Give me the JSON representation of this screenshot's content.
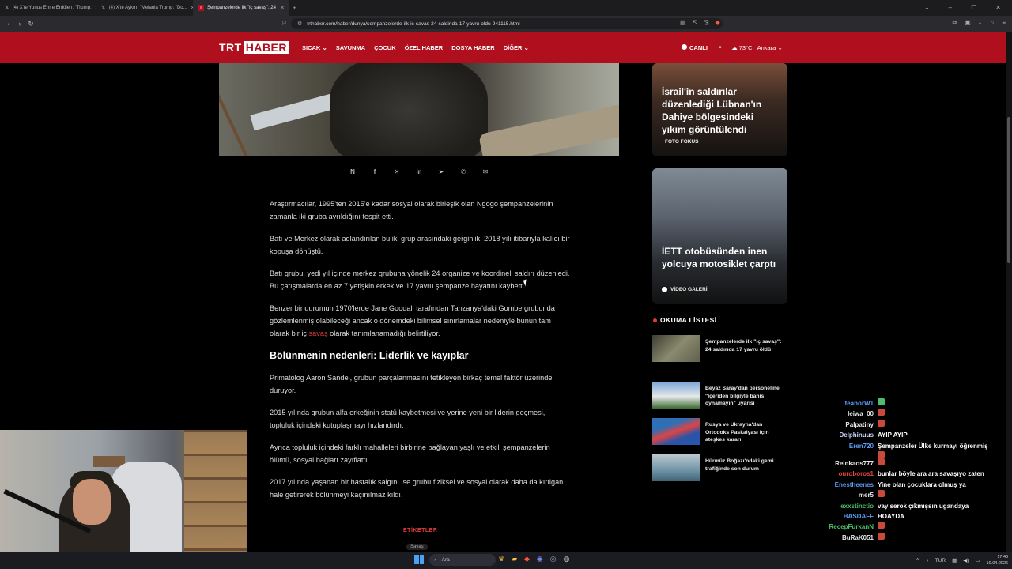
{
  "browser": {
    "tabs": [
      {
        "label": "(4) X'te Yunus Emre Erdölen: \"Trump:",
        "active": false
      },
      {
        "label": "(4) X'te Aykırı: \"Melania Trump: \"Do...",
        "active": false
      },
      {
        "label": "Şempanzelerde ilk \"iç savaş\": 24",
        "active": true
      }
    ],
    "url": "trthaber.com/haber/dunya/sempanzelerde-ilk-ic-savas-24-saldirida-17-yavru-oldu-941115.html"
  },
  "site": {
    "logo_trt": "TRT",
    "logo_haber": "HABER",
    "nav": [
      "SICAK",
      "SAVUNMA",
      "ÇOCUK",
      "ÖZEL HABER",
      "DOSYA HABER",
      "DİĞER"
    ],
    "live_label": "CANLI",
    "weather": "73°C",
    "city": "Ankara"
  },
  "share_icons": [
    "N",
    "f",
    "x-icon",
    "in",
    "telegram-icon",
    "whatsapp-icon",
    "mail-icon"
  ],
  "article": {
    "p1": "Araştırmacılar, 1995'ten 2015'e kadar sosyal olarak birleşik olan Ngogo şempanzelerinin zamanla iki gruba ayrıldığını tespit etti.",
    "p2": "Batı ve Merkez olarak adlandırılan bu iki grup arasındaki gerginlik, 2018 yılı itibarıyla kalıcı bir kopuşa dönüştü.",
    "p3": "Batı grubu, yedi yıl içinde merkez grubuna yönelik 24 organize ve koordineli saldırı düzenledi. Bu çatışmalarda en az 7 yetişkin erkek ve 17 yavru şempanze hayatını kaybetti.",
    "p4_before": "Benzer bir durumun 1970'lerde Jane Goodall tarafından Tanzanya'daki Gombe grubunda gözlemlenmiş olabileceği ancak o dönemdeki bilimsel sınırlamalar nedeniyle bunun tam olarak bir iç ",
    "p4_link": "savaş",
    "p4_after": " olarak tanımlanamadığı belirtiliyor.",
    "h2": "Bölünmenin nedenleri: Liderlik ve kayıplar",
    "p5": "Primatolog Aaron Sandel, grubun parçalanmasını tetikleyen birkaç temel faktör üzerinde duruyor.",
    "p6": "2015 yılında grubun alfa erkeğinin statü kaybetmesi ve yerine yeni bir liderin geçmesi, topluluk içindeki kutuplaşmayı hızlandırdı.",
    "p7": "Ayrıca topluluk içindeki farklı mahalleleri birbirine bağlayan yaşlı ve etkili şempanzelerin ölümü, sosyal bağları zayıflattı.",
    "p8": "2017 yılında yaşanan bir hastalık salgını ise grubu fiziksel ve sosyal olarak daha da kırılgan hale getirerek bölünmeyi kaçınılmaz kıldı.",
    "tags_title": "ETİKETLER",
    "tag1": "Savaş"
  },
  "sidebar": {
    "card1": {
      "title": "İsrail'in saldırılar düzenlediği Lübnan'ın Dahiye bölgesindeki yıkım görüntülendi",
      "tag": "FOTO FOKUS"
    },
    "card2": {
      "title": "İETT otobüsünden inen yolcuya motosiklet çarptı",
      "tag": "VİDEO GALERİ"
    },
    "reading_title": "OKUMA LİSTESİ",
    "reading": [
      {
        "text": "Şempanzelerde ilk \"iç savaş\": 24 saldırıda 17 yavru öldü",
        "color": "#6b6a55"
      },
      {
        "text": "Beyaz Saray'dan personeline \"içeriden bilgiyle bahis oynamayın\" uyarısı",
        "color": "#5a84b8"
      },
      {
        "text": "Rusya ve Ukrayna'dan Ortodoks Paskalyası için ateşkes kararı",
        "color": "#2f6fb5"
      },
      {
        "text": "Hürmüz Boğazı'ndaki gemi trafiğinde son durum",
        "color": "#6f93a6"
      }
    ]
  },
  "chat": [
    {
      "user": "feanorW1",
      "msg": "",
      "color": "#5a9cf5",
      "emote": "green"
    },
    {
      "user": "leiwa_00",
      "msg": "",
      "color": "#e6e6e6",
      "emote": "red"
    },
    {
      "user": "Palpatiny",
      "msg": "",
      "color": "#e6e6e6",
      "emote": "red"
    },
    {
      "user": "Delphinuus",
      "msg": "AYIP AYIP",
      "color": "#cfd6ff",
      "emote": ""
    },
    {
      "user": "Eren720",
      "msg": "Şempanzeler Ülke kurmayı öğrenmiş",
      "color": "#5a9cf5",
      "emote": ""
    },
    {
      "user": "",
      "msg": "",
      "color": "#e6e6e6",
      "emote": "red"
    },
    {
      "user": "Reinkaos777",
      "msg": "",
      "color": "#e6e6e6",
      "emote": "red"
    },
    {
      "user": "ouroboros1",
      "msg": "bunlar böyle ara ara savaşıyo zaten",
      "color": "#e0463c",
      "emote": ""
    },
    {
      "user": "Enestheenes",
      "msg": "Yine olan çocuklara olmuş ya",
      "color": "#5a9cf5",
      "emote": ""
    },
    {
      "user": "mer5",
      "msg": "",
      "color": "#e6e6e6",
      "emote": "red"
    },
    {
      "user": "exxstinctio",
      "msg": "vay serok çıkmışsın ugandaya",
      "color": "#4bbd6c",
      "emote": ""
    },
    {
      "user": "BASDAFF",
      "msg": "HOAYDA",
      "color": "#5a9cf5",
      "emote": ""
    },
    {
      "user": "RecepFurkanN",
      "msg": "",
      "color": "#4bbd6c",
      "emote": "red"
    },
    {
      "user": "BuRaK051",
      "msg": "",
      "color": "#e6e6e6",
      "emote": "red"
    }
  ],
  "taskbar": {
    "search_label": "Ara",
    "lang": "TUR",
    "time": "17:46",
    "date": "10.04.2026"
  }
}
